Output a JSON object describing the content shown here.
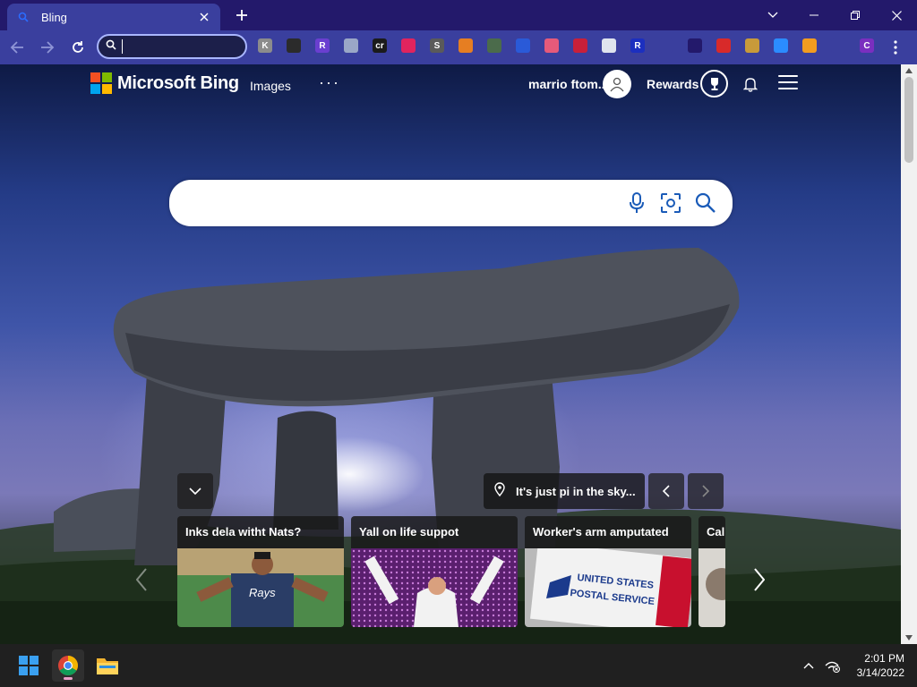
{
  "browser": {
    "tab_title": "Bling",
    "omnibox_value": "",
    "extensions": [
      {
        "icon": "ext-gray-k",
        "label": "K",
        "color": "#8c8c8c"
      },
      {
        "icon": "ext-dark-orb",
        "label": "",
        "color": "#2b2b2b"
      },
      {
        "icon": "ext-purple-r",
        "label": "R",
        "color": "#6a3fd0"
      },
      {
        "icon": "ext-cloud",
        "label": "",
        "color": "#9aa7c7"
      },
      {
        "icon": "ext-cr",
        "label": "cr",
        "color": "#1b1b1b"
      },
      {
        "icon": "ext-red-cursor",
        "label": "",
        "color": "#e0245e"
      },
      {
        "icon": "ext-s",
        "label": "S",
        "color": "#5a5a5a"
      },
      {
        "icon": "ext-color-wheel",
        "label": "",
        "color": "#e67e22"
      },
      {
        "icon": "ext-box",
        "label": "",
        "color": "#4b6b4b"
      },
      {
        "icon": "ext-grid",
        "label": "",
        "color": "#2a5ad8"
      },
      {
        "icon": "ext-flag",
        "label": "",
        "color": "#e65a7a"
      },
      {
        "icon": "ext-red-square",
        "label": "",
        "color": "#c8203a"
      },
      {
        "icon": "ext-shield",
        "label": "",
        "color": "#dfe4ee"
      },
      {
        "icon": "ext-blue-r",
        "label": "R",
        "color": "#1c2fbf"
      },
      {
        "icon": "ext-infinity",
        "label": "",
        "color": "#3a3f9e"
      },
      {
        "icon": "ext-robot",
        "label": "",
        "color": "#23196b"
      },
      {
        "icon": "ext-card",
        "label": "",
        "color": "#d82a2a"
      },
      {
        "icon": "ext-cat",
        "label": "",
        "color": "#c89a3a"
      },
      {
        "icon": "ext-play",
        "label": "",
        "color": "#2b8cff"
      },
      {
        "icon": "ext-honey",
        "label": "",
        "color": "#f29c1f"
      },
      {
        "icon": "ext-puzzle",
        "label": "",
        "color": "#3a3f9e"
      },
      {
        "icon": "ext-profile-c",
        "label": "C",
        "color": "#7a2fbf"
      }
    ]
  },
  "bing": {
    "logo_text": "Microsoft Bing",
    "images_link": "Images",
    "more_link": "···",
    "user_name": "marrio ftom...",
    "rewards_label": "Rewards",
    "search_value": "",
    "image_caption": "It's just pi in the sky...",
    "news": [
      {
        "title": "Inks dela witht Nats?"
      },
      {
        "title": "Yall on life suppot"
      },
      {
        "title": "Worker's arm amputated"
      },
      {
        "title": "Call"
      }
    ],
    "postal_text_1": "UNITED STATES",
    "postal_text_2": "POSTAL SERVICE",
    "jersey_text": "Rays"
  },
  "taskbar": {
    "time": "2:01 PM",
    "date": "3/14/2022"
  },
  "colors": {
    "titlebar": "#23196b",
    "toolbar": "#3a3f9e",
    "taskbar": "#202020"
  }
}
